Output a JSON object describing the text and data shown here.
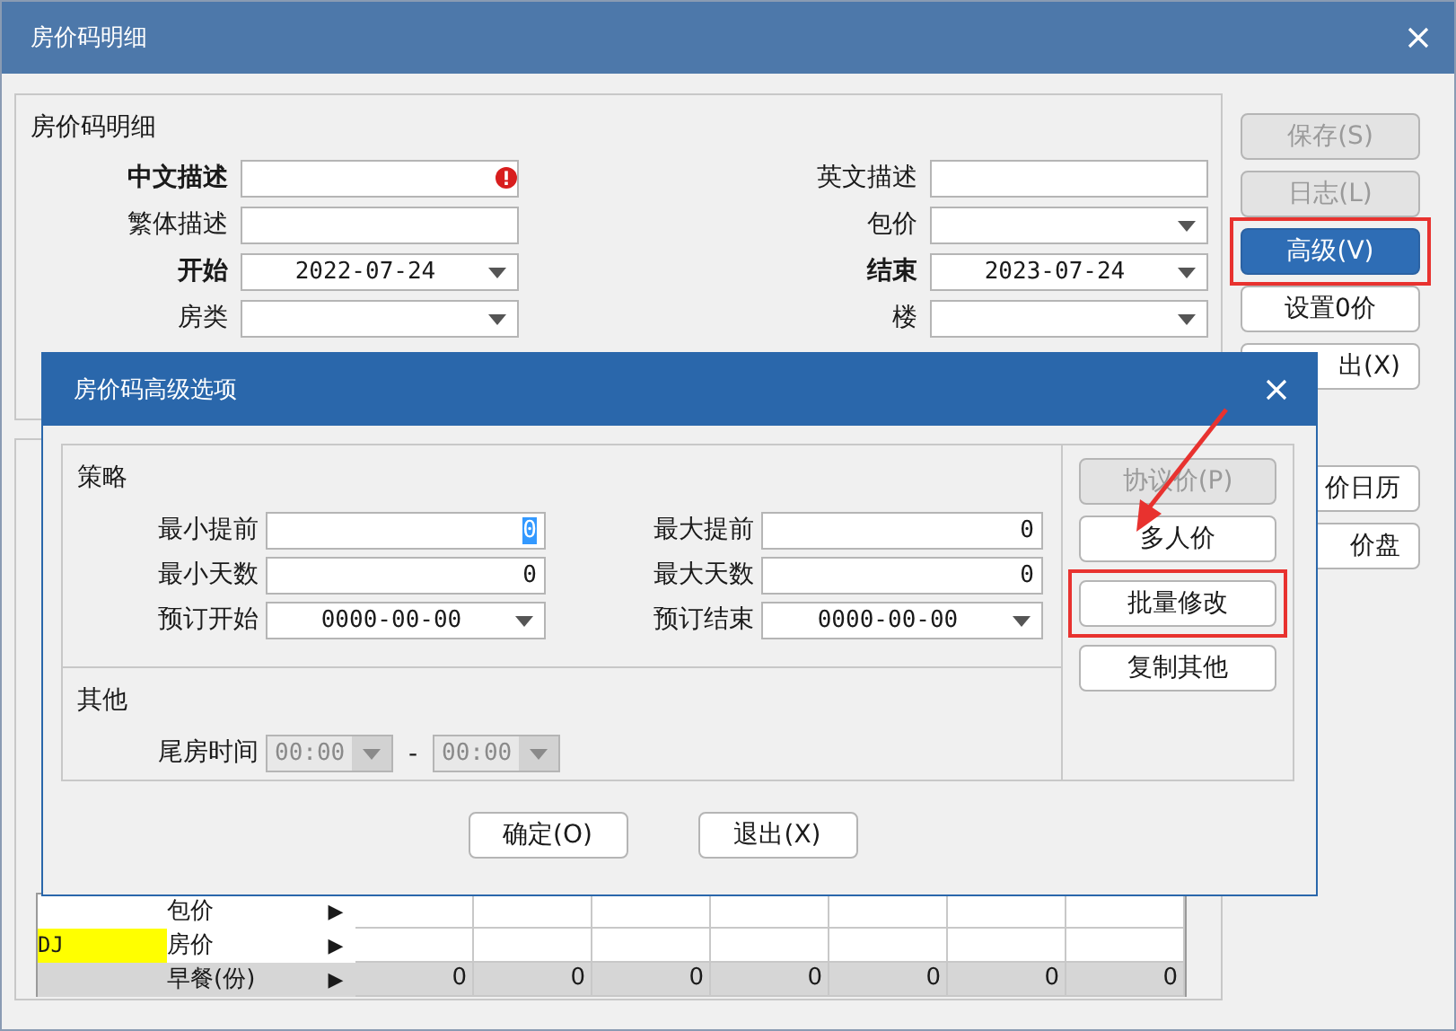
{
  "window": {
    "title": "房价码明细"
  },
  "details": {
    "title": "房价码明细",
    "fields": [
      {
        "label": "中文描述",
        "bold": true,
        "kind": "text",
        "error": true
      },
      {
        "label": "英文描述",
        "bold": false,
        "kind": "text",
        "error": false
      },
      {
        "label": "繁体描述",
        "bold": false,
        "kind": "text",
        "error": false
      },
      {
        "label": "包价",
        "bold": false,
        "kind": "select",
        "error": false
      },
      {
        "label": "开始",
        "bold": true,
        "kind": "select",
        "value": "2022-07-24",
        "error": false
      },
      {
        "label": "结束",
        "bold": true,
        "kind": "select",
        "value": "2023-07-24",
        "error": false
      },
      {
        "label": "房类",
        "bold": false,
        "kind": "select",
        "error": false
      },
      {
        "label": "楼",
        "bold": false,
        "kind": "select",
        "error": false
      }
    ]
  },
  "side_buttons": [
    {
      "label": "保存(S)",
      "disabled": true,
      "selected": false,
      "highlighted": false,
      "covered": false
    },
    {
      "label": "日志(L)",
      "disabled": true,
      "selected": false,
      "highlighted": false,
      "covered": false
    },
    {
      "label": "高级(V)",
      "disabled": false,
      "selected": true,
      "highlighted": true,
      "covered": false
    },
    {
      "label": "设置0价",
      "disabled": false,
      "selected": false,
      "highlighted": false,
      "covered": false
    },
    {
      "label": "出(X)",
      "disabled": false,
      "selected": false,
      "highlighted": false,
      "covered": true
    }
  ],
  "lower": {
    "buttons": [
      {
        "label": "价日历"
      },
      {
        "label": "价盘"
      }
    ],
    "grid": {
      "rows": [
        {
          "label": "包价",
          "arrow": "▶",
          "kind": "input"
        },
        {
          "code": "DJ",
          "color": "#ffff00",
          "label": "房价",
          "arrow": "▶",
          "kind": "input"
        },
        {
          "label": "早餐(份)",
          "arrow": "▶",
          "kind": "readonly",
          "cells": [
            "0",
            "0",
            "0",
            "0",
            "0",
            "0",
            "0"
          ]
        }
      ]
    }
  },
  "dialog": {
    "title": "房价码高级选项",
    "strategy": {
      "title": "策略",
      "fields": [
        {
          "label": "最小提前",
          "kind": "number",
          "value": "0",
          "selected": true
        },
        {
          "label": "最大提前",
          "kind": "number",
          "value": "0",
          "selected": false
        },
        {
          "label": "最小天数",
          "kind": "number",
          "value": "0",
          "selected": false
        },
        {
          "label": "最大天数",
          "kind": "number",
          "value": "0",
          "selected": false
        },
        {
          "label": "预订开始",
          "kind": "select",
          "value": "0000-00-00",
          "selected": false
        },
        {
          "label": "预订结束",
          "kind": "select",
          "value": "0000-00-00",
          "selected": false
        }
      ]
    },
    "other": {
      "title": "其他",
      "label": "尾房时间",
      "from": "00:00",
      "separator": "-",
      "to": "00:00",
      "disabled": true
    },
    "side_buttons": [
      {
        "label": "协议价(P)",
        "disabled": true,
        "highlighted": false
      },
      {
        "label": "多人价",
        "disabled": false,
        "highlighted": false
      },
      {
        "label": "批量修改",
        "disabled": false,
        "highlighted": true
      },
      {
        "label": "复制其他",
        "disabled": false,
        "highlighted": false
      }
    ],
    "buttons": [
      "确定(O)",
      "退出(X)"
    ]
  }
}
